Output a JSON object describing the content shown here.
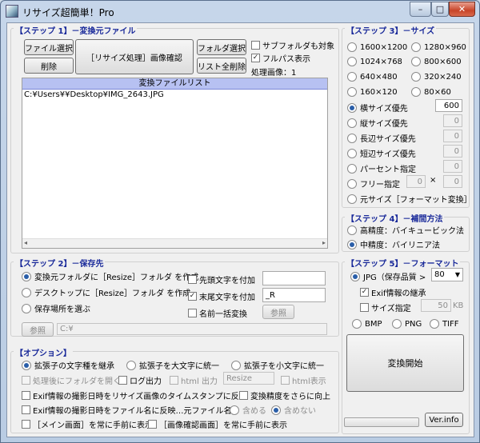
{
  "window": {
    "title": "リサイズ超簡単！Pro",
    "minimize": "–",
    "maximize": "□",
    "close": "✕"
  },
  "step1": {
    "title": "【ステップ 1】－変換元ファイル",
    "file_select": "ファイル選択",
    "resize_confirm": "［リサイズ処理］画像確認",
    "folder_select": "フォルダ選択",
    "delete": "削除",
    "list_clear": "リスト全削除",
    "subfolder_label": "サブフォルダも対象",
    "fullpath_label": "フルパス表示",
    "processed_label": "処理画像：",
    "processed_count": "1",
    "list_header": "変換ファイルリスト",
    "files": [
      "C:¥Users¥¥Desktop¥IMG_2643.JPG"
    ]
  },
  "step2": {
    "title": "【ステップ 2】－保存先",
    "opt1": "変換元フォルダに［Resize］フォルダ を作成",
    "opt2": "デスクトップに［Resize］フォルダ を作成",
    "opt3": "保存場所を選ぶ",
    "prefix_label": "先頭文字を付加",
    "suffix_label": "末尾文字を付加",
    "suffix_value": "_R",
    "rename_label": "名前一括変換",
    "rename_button": "参照",
    "browse_button": "参照",
    "path_value": "C:¥"
  },
  "step3": {
    "title": "【ステップ 3】－サイズ",
    "sizes": [
      "1600×1200",
      "1280×960",
      "1024×768",
      "800×600",
      "640×480",
      "320×240",
      "160×120",
      "80×60"
    ],
    "width_label": "横サイズ優先",
    "width_value": "600",
    "height_label": "縦サイズ優先",
    "height_value": "0",
    "long_label": "長辺サイズ優先",
    "long_value": "0",
    "short_label": "短辺サイズ優先",
    "short_value": "0",
    "percent_label": "パーセント指定",
    "percent_value": "0",
    "free_label": "フリー指定",
    "free_w": "0",
    "free_x": "×",
    "free_h": "0",
    "original_label": "元サイズ［フォーマット変換］"
  },
  "step4": {
    "title": "【ステップ 4】－補間方法",
    "high": "高精度：バイキュービック法",
    "mid": "中精度：バイリニア法"
  },
  "step5": {
    "title": "【ステップ 5】－フォーマット",
    "jpg_label": "JPG（保存品質 >",
    "quality": "80",
    "exif_label": "Exif情報の継承",
    "size_spec_label": "サイズ指定",
    "size_spec_value": "50",
    "size_spec_unit": "KB",
    "bmp": "BMP",
    "png": "PNG",
    "tiff": "TIFF",
    "convert_button": "変換開始",
    "verinfo_button": "Ver.info"
  },
  "options": {
    "title": "【オプション】",
    "keep_case": "拡張子の文字種を継承",
    "upper_case": "拡張子を大文字に統一",
    "lower_case": "拡張子を小文字に統一",
    "open_folder": "処理後にフォルダを開く",
    "log_output": "ログ出力",
    "html_output": "html 出力",
    "html_value": "Resize",
    "html_view": "html表示",
    "exif_timestamp": "Exif情報の撮影日時をリサイズ画像のタイムスタンプに反映",
    "precision_up": "変換精度をさらに向上",
    "exif_filename": "Exif情報の撮影日時をファイル名に反映…元ファイル名：",
    "include": "含める",
    "exclude": "含めない",
    "main_front": "［メイン画面］を常に手前に表示",
    "preview_front": "［画像確認画面］を常に手前に表示"
  }
}
